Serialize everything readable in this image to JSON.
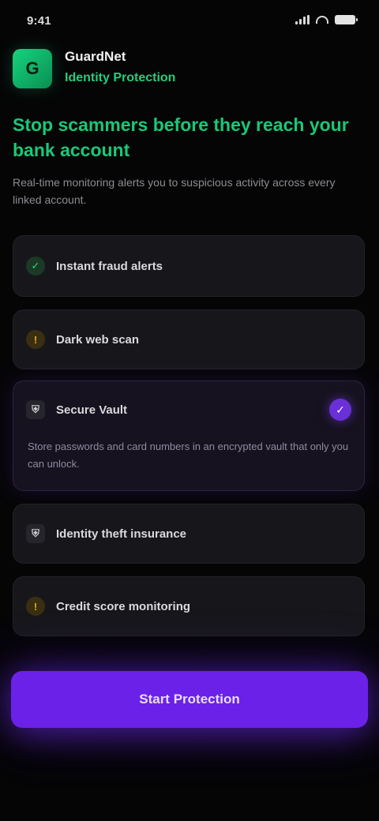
{
  "status_bar": {
    "time": "9:41"
  },
  "header": {
    "logo_glyph": "G",
    "brand_name": "GuardNet",
    "brand_subtitle": "Identity Protection"
  },
  "headline": "Stop scammers before they reach your bank account",
  "description": "Real-time monitoring alerts you to suspicious activity across every linked account.",
  "features": [
    {
      "icon": "check-circle-icon",
      "glyph": "✓",
      "label": "Instant fraud alerts"
    },
    {
      "icon": "warning-icon",
      "glyph": "!",
      "label": "Dark web scan"
    }
  ],
  "selected_card": {
    "icon": "shield-icon",
    "glyph": "⛨",
    "title": "Secure Vault",
    "check_glyph": "✓",
    "body": "Store passwords and card numbers in an encrypted vault that only you can unlock."
  },
  "more_features": [
    {
      "icon": "shield-icon",
      "glyph": "⛨",
      "label": "Identity theft insurance"
    },
    {
      "icon": "warning-icon",
      "glyph": "!",
      "label": "Credit score monitoring"
    }
  ],
  "cta": {
    "label": "Start Protection"
  },
  "colors": {
    "accent_green": "#18c978",
    "accent_purple": "#6b21e8",
    "background": "#050506"
  }
}
